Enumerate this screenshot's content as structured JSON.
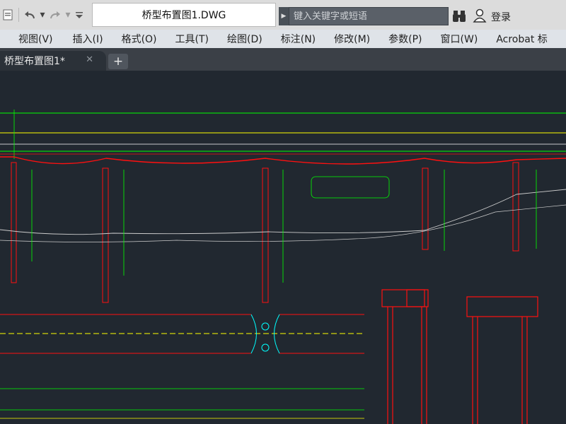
{
  "window": {
    "title": "桥型布置图1.DWG"
  },
  "search": {
    "placeholder": "键入关键字或短语"
  },
  "user": {
    "login_label": "登录"
  },
  "menu": {
    "items": [
      "视图(V)",
      "插入(I)",
      "格式(O)",
      "工具(T)",
      "绘图(D)",
      "标注(N)",
      "修改(M)",
      "参数(P)",
      "窗口(W)",
      "Acrobat 标"
    ]
  },
  "tabs": [
    {
      "label": "桥型布置图1*",
      "close_icon": "close-icon"
    }
  ],
  "icons": {
    "undo": "undo-icon",
    "redo": "redo-icon",
    "dropdown": "dropdown-arrow-icon",
    "quick_access_menu": "quick-access-menu-icon",
    "search_arrow": "search-expand-arrow-icon",
    "binoculars": "binoculars-icon",
    "user": "user-icon",
    "new_tab": "plus-icon"
  },
  "colors": {
    "canvas_bg": "#212830",
    "green_line": "#00ff00",
    "red_line": "#ff1010",
    "yellow_line": "#ffff00",
    "white_line": "#ffffff",
    "cyan_line": "#00ffff"
  }
}
